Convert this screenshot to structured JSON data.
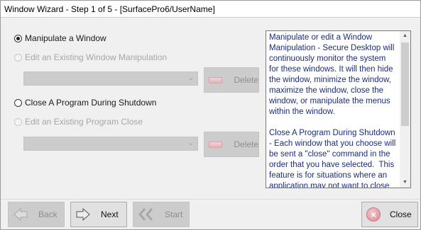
{
  "window": {
    "title": "Window Wizard - Step 1 of 5 - [SurfacePro6/UserName]"
  },
  "options": {
    "manipulate_window": {
      "label": "Manipulate a Window",
      "checked": true,
      "enabled": true
    },
    "edit_existing_manipulation": {
      "label": "Edit an Existing Window Manipulation",
      "checked": false,
      "enabled": false
    },
    "close_program": {
      "label": "Close A Program During Shutdown",
      "checked": false,
      "enabled": true
    },
    "edit_existing_close": {
      "label": "Edit an Existing Program Close",
      "checked": false,
      "enabled": false
    }
  },
  "manipulation_select": {
    "value": "",
    "enabled": false
  },
  "close_select": {
    "value": "",
    "enabled": false
  },
  "delete_manipulation_button": {
    "label": "Delete",
    "enabled": false
  },
  "delete_close_button": {
    "label": "Delete",
    "enabled": false
  },
  "description": {
    "text": "Manipulate or edit a Window Manipulation - Secure Desktop will continuously monitor the system for these windows. It will then hide the window, minimize the window, maximize the window, close the window, or manipulate the menus within the window.\n\nClose A Program During Shutdown - Each window that you choose will be sent a \"close\" command in the order that you have selected.  This feature is for situations where an application may not want to close due to its dependency on"
  },
  "footer": {
    "back": {
      "label": "Back",
      "enabled": false
    },
    "next": {
      "label": "Next",
      "enabled": true
    },
    "start": {
      "label": "Start",
      "enabled": false
    },
    "close": {
      "label": "Close",
      "enabled": true
    }
  },
  "colors": {
    "description_text": "#1c2d7a",
    "client_background": "#f0f0f0",
    "disabled_control": "#cccccc",
    "close_icon": "#d88a93"
  },
  "icons": {
    "back": "back-arrow-icon",
    "next": "next-arrow-icon",
    "start": "double-chevron-icon",
    "delete": "delete-bar-icon",
    "close": "close-x-icon",
    "scroll_up": "scroll-up-icon",
    "scroll_down": "scroll-down-icon"
  }
}
